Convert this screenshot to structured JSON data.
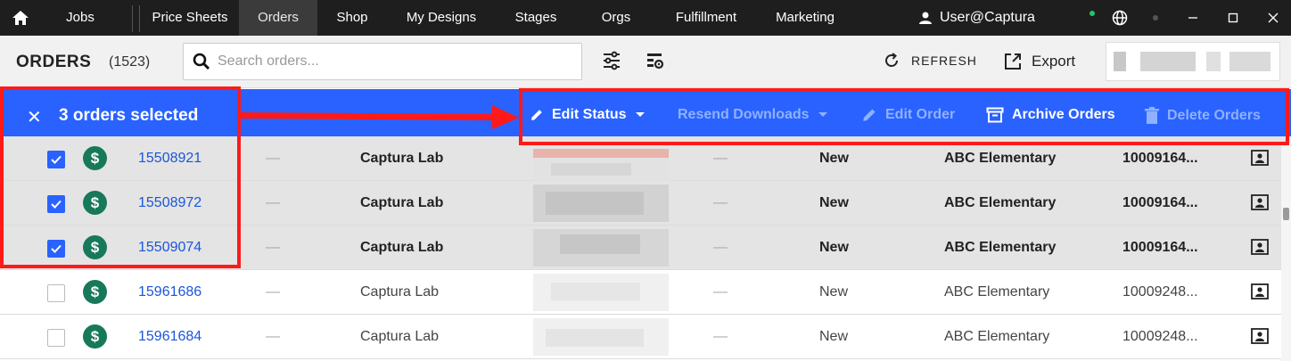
{
  "nav": {
    "items": [
      "Jobs",
      "Price Sheets",
      "Orders",
      "Shop",
      "My Designs",
      "Stages",
      "Orgs",
      "Fulfillment",
      "Marketing"
    ],
    "active": "Orders",
    "user": "User@Captura",
    "icons": [
      "home-icon",
      "user-icon",
      "globe-icon",
      "minimize-icon",
      "maximize-icon",
      "close-icon"
    ]
  },
  "header": {
    "title": "ORDERS",
    "count": "(1523)",
    "search_placeholder": "Search orders...",
    "refresh_label": "REFRESH",
    "export_label": "Export"
  },
  "selection": {
    "text": "3 orders selected",
    "close": "✕",
    "actions": {
      "edit_status": "Edit Status",
      "resend_downloads": "Resend Downloads",
      "edit_order": "Edit Order",
      "archive_orders": "Archive Orders",
      "delete_orders": "Delete Orders"
    }
  },
  "rows": [
    {
      "order": "15508921",
      "dash1": "—",
      "lab": "Captura Lab",
      "dash2": "—",
      "status": "New",
      "org": "ABC Elementary",
      "code": "10009164...",
      "selected": true
    },
    {
      "order": "15508972",
      "dash1": "—",
      "lab": "Captura Lab",
      "dash2": "—",
      "status": "New",
      "org": "ABC Elementary",
      "code": "10009164...",
      "selected": true
    },
    {
      "order": "15509074",
      "dash1": "—",
      "lab": "Captura Lab",
      "dash2": "—",
      "status": "New",
      "org": "ABC Elementary",
      "code": "10009164...",
      "selected": true
    },
    {
      "order": "15961686",
      "dash1": "—",
      "lab": "Captura Lab",
      "dash2": "—",
      "status": "New",
      "org": "ABC Elementary",
      "code": "10009248...",
      "selected": false
    },
    {
      "order": "15961684",
      "dash1": "—",
      "lab": "Captura Lab",
      "dash2": "—",
      "status": "New",
      "org": "ABC Elementary",
      "code": "10009248...",
      "selected": false
    }
  ],
  "colors": {
    "accent": "#2962ff",
    "annotation": "#ff1a1a",
    "paid_icon": "#17795a",
    "link": "#1a56db",
    "nav_bg": "#1e1e1e"
  }
}
